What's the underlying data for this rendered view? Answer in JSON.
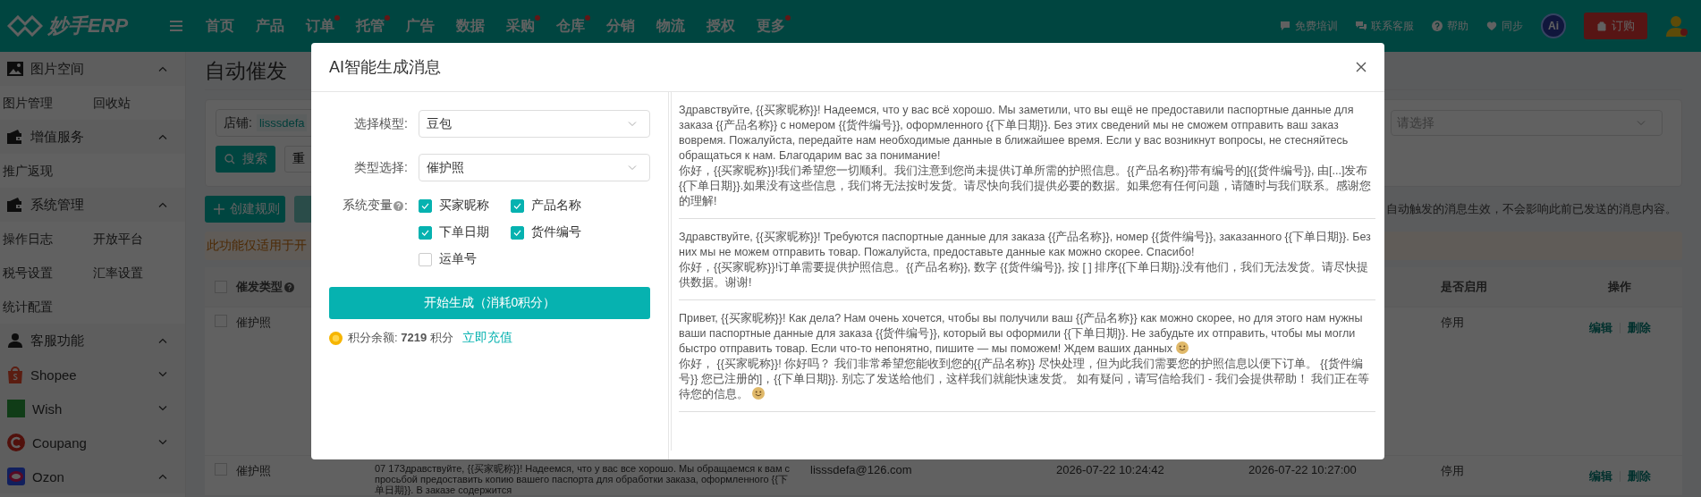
{
  "header": {
    "logo": "妙手ERP",
    "nav": [
      {
        "label": "首页",
        "badge": false
      },
      {
        "label": "产品",
        "badge": false
      },
      {
        "label": "订单",
        "badge": true
      },
      {
        "label": "托管",
        "badge": true
      },
      {
        "label": "广告",
        "badge": false
      },
      {
        "label": "数据",
        "badge": false
      },
      {
        "label": "采购",
        "badge": true
      },
      {
        "label": "仓库",
        "badge": true
      },
      {
        "label": "分销",
        "badge": false
      },
      {
        "label": "物流",
        "badge": false
      },
      {
        "label": "授权",
        "badge": false
      },
      {
        "label": "更多",
        "badge": true
      }
    ],
    "tools": [
      "免费培训",
      "联系客服",
      "帮助",
      "同步"
    ],
    "ai_badge": "Ai",
    "order_button": "订购"
  },
  "sidebar": [
    {
      "title": "图片空间",
      "expanded": true,
      "items": [
        "图片管理",
        "回收站"
      ]
    },
    {
      "title": "增值服务",
      "expanded": true,
      "items": [
        "推广返现"
      ]
    },
    {
      "title": "系统管理",
      "expanded": true,
      "items": [
        "操作日志",
        "开放平台",
        "税号设置",
        "汇率设置",
        "统计配置"
      ]
    },
    {
      "title": "客服功能",
      "expanded": true
    },
    {
      "title": "Shopee",
      "expanded": false
    },
    {
      "title": "Wish",
      "expanded": false
    },
    {
      "title": "Coupang",
      "expanded": false
    },
    {
      "title": "Ozon",
      "expanded": true
    }
  ],
  "page": {
    "title": "自动催发",
    "filter": {
      "shop_label": "店铺:",
      "shop_value": "lisssdefa",
      "search_button": "搜索",
      "reset_button": "重",
      "select_placeholder": "请选择"
    },
    "create_button": "创建规则",
    "notice": {
      "info": "自动触发的消息生效，不会影响此前已发送的消息内容。",
      "warning": "此功能仅适用于开"
    },
    "table": {
      "select_all": false,
      "columns": {
        "type": "催发类型",
        "enabled": "是否启用",
        "operations": "操作"
      },
      "rows": [
        {
          "checked": false,
          "type": "催护照",
          "enabled": "停用",
          "edit": "编辑",
          "delete": "删除"
        },
        {
          "checked": false,
          "type": "催护照",
          "content": "07 17Здравствуйте, {{买家昵称}}! Надеемся, что у вас все хорошо. Мы обращаемся к вам с просьбой предоставить копию вашего паспорта для обработки заказа, оформленного {{下单日期}}. В заказе содержится",
          "email": "lisssdefa@126.com",
          "created": "2026-07-22 10:24:42",
          "updated": "2026-07-22 10:27:00",
          "enabled": "停用",
          "edit": "编辑",
          "delete": "删除"
        }
      ]
    }
  },
  "modal": {
    "title": "AI智能生成消息",
    "model_label": "选择模型:",
    "model_value": "豆包",
    "type_label": "类型选择:",
    "type_value": "催护照",
    "variables_label": "系统变量",
    "variables_colon": ":",
    "variables": [
      {
        "label": "买家昵称",
        "checked": true
      },
      {
        "label": "产品名称",
        "checked": true
      },
      {
        "label": "下单日期",
        "checked": true
      },
      {
        "label": "货件编号",
        "checked": true
      },
      {
        "label": "运单号",
        "checked": false
      }
    ],
    "generate_button": "开始生成（消耗0积分）",
    "balance": "积分余额: **7219** 积分",
    "recharge_link": "立即充值",
    "messages": [
      [
        {
          "text": "Здравствуйте, {{买家昵称}}! Надеемся, что у вас всё хорошо. Мы заметили, что вы ещё не предоставили паспортные данные для заказа {{产品名称}} с номером {{货件编号}}, оформленного {{下单日期}}. Без этих сведений мы не сможем отправить ваш заказ вовремя. Пожалуйста, передайте нам необходимые данные в ближайшее время. Если у вас возникнут вопросы, не стесняйтесь обращаться к нам. Благодарим вас за понимание!",
          "smiley": false
        },
        {
          "text": "你好，{{买家昵称}}!我们希望您一切顺利。我们注意到您尚未提供订单所需的护照信息。{{产品名称}}带有编号的]{{货件编号}}, 由[...]发布{{下单日期}}.如果没有这些信息，我们将无法按时发货。请尽快向我们提供必要的数据。如果您有任何问题，请随时与我们联系。感谢您的理解!",
          "smiley": false
        }
      ],
      [
        {
          "text": "Здравствуйте, {{买家昵称}}! Требуются паспортные данные для заказа {{产品名称}}, номер {{货件编号}}, заказанного {{下单日期}}. Без них мы не можем отправить товар. Пожалуйста, предоставьте данные как можно скорее. Спасибо!",
          "smiley": false
        },
        {
          "text": "你好，{{买家昵称}}!订单需要提供护照信息。{{产品名称}}, 数字 {{货件编号}}, 按 [ ] 排序{{下单日期}}.没有他们，我们无法发货。请尽快提供数据。谢谢!",
          "smiley": false
        }
      ],
      [
        {
          "text": "Привет, {{买家昵称}}! Как дела? Нам очень хочется, чтобы вы получили ваш {{产品名称}} как можно скорее, но для этого нам нужны ваши паспортные данные для заказа {{货件编号}}, который вы оформили {{下单日期}}. Не забудьте их отправить, чтобы мы могли быстро отправить товар. Если что-то непонятно, пишите — мы поможем! Ждем ваших данных",
          "smiley": true
        },
        {
          "text": "你好， {{买家昵称}}! 你好吗？ 我们非常希望您能收到您的{{产品名称}} 尽快处理，但为此我们需要您的护照信息以便下订单。 {{货件编号}} 您已注册的]，{{下单日期}}. 别忘了发送给他们，这样我们就能快速发货。 如有疑问，请写信给我们 - 我们会提供帮助！ 我们正在等待您的信息。",
          "smiley": true
        }
      ]
    ]
  }
}
